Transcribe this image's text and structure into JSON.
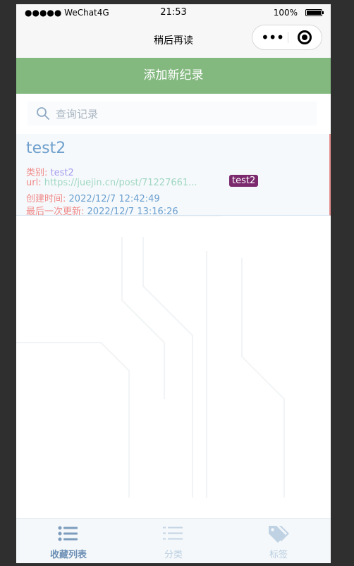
{
  "status_bar": {
    "carrier": "●●●●● WeChat4G",
    "time": "21:53",
    "battery": "100%"
  },
  "nav": {
    "title": "稍后再读"
  },
  "add_button": {
    "label": "添加新纪录"
  },
  "search": {
    "placeholder": "查询记录",
    "value": ""
  },
  "records": [
    {
      "title": "test2",
      "category_label": "类别:",
      "category": "test2",
      "url_label": "url:",
      "url": "https://juejin.cn/post/71227661...",
      "created_label": "创建时间:",
      "created": "2022/12/7 12:42:49",
      "updated_label": "最后一次更新:",
      "updated": "2022/12/7 13:16:26",
      "tag": "test2"
    }
  ],
  "tabs": [
    {
      "label": "收藏列表",
      "icon": "list-icon",
      "active": true
    },
    {
      "label": "分类",
      "icon": "category-icon",
      "active": false
    },
    {
      "label": "标签",
      "icon": "tag-icon",
      "active": false
    }
  ],
  "colors": {
    "accent_green": "#83b87f",
    "tag_badge": "#7b2a6e",
    "label_red": "#f08a8a",
    "title_blue": "#6fa0cd"
  }
}
